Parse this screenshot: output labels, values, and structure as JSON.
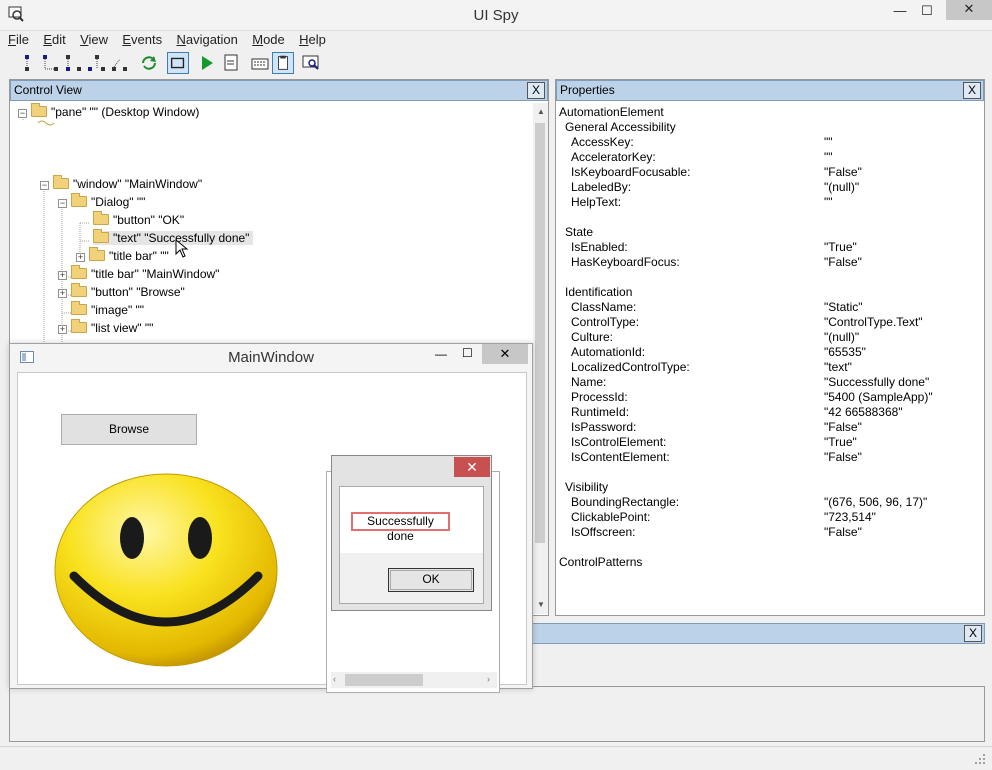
{
  "app": {
    "title": "UI Spy"
  },
  "menu": [
    "File",
    "Edit",
    "View",
    "Events",
    "Navigation",
    "Mode",
    "Help"
  ],
  "toolbar_icons": [
    "navigate-parent-icon",
    "navigate-first-child-icon",
    "navigate-next-sibling-icon",
    "navigate-prev-sibling-icon",
    "navigate-last-child-icon",
    "refresh-icon",
    "hover-mode-icon",
    "play-icon",
    "focus-tracking-icon",
    "keyboard-icon",
    "clipboard-icon",
    "screen-capture-icon"
  ],
  "control_view": {
    "title": "Control View",
    "close": "X",
    "tree": [
      {
        "text": "\"pane\" \"\" (Desktop Window)"
      },
      {
        "text": "\"window\" \"MainWindow\""
      },
      {
        "text": "\"Dialog\" \"\""
      },
      {
        "text": "\"button\" \"OK\""
      },
      {
        "text": "\"text\" \"Successfully done\""
      },
      {
        "text": "\"title bar\" \"\""
      },
      {
        "text": "\"title bar\" \"MainWindow\""
      },
      {
        "text": "\"button\" \"Browse\""
      },
      {
        "text": "\"image\" \"\""
      },
      {
        "text": "\"list view\" \"\""
      }
    ]
  },
  "properties": {
    "title": "Properties",
    "close": "X",
    "root": "AutomationElement",
    "sections": [
      {
        "name": "General Accessibility",
        "rows": [
          {
            "k": "AccessKey:",
            "v": "\"\""
          },
          {
            "k": "AcceleratorKey:",
            "v": "\"\""
          },
          {
            "k": "IsKeyboardFocusable:",
            "v": "\"False\""
          },
          {
            "k": "LabeledBy:",
            "v": "\"(null)\""
          },
          {
            "k": "HelpText:",
            "v": "\"\""
          }
        ]
      },
      {
        "name": "State",
        "rows": [
          {
            "k": "IsEnabled:",
            "v": "\"True\""
          },
          {
            "k": "HasKeyboardFocus:",
            "v": "\"False\""
          }
        ]
      },
      {
        "name": "Identification",
        "rows": [
          {
            "k": "ClassName:",
            "v": "\"Static\""
          },
          {
            "k": "ControlType:",
            "v": "\"ControlType.Text\""
          },
          {
            "k": "Culture:",
            "v": "\"(null)\""
          },
          {
            "k": "AutomationId:",
            "v": "\"65535\""
          },
          {
            "k": "LocalizedControlType:",
            "v": "\"text\""
          },
          {
            "k": "Name:",
            "v": "\"Successfully done\""
          },
          {
            "k": "ProcessId:",
            "v": "\"5400 (SampleApp)\""
          },
          {
            "k": "RuntimeId:",
            "v": "\"42 66588368\""
          },
          {
            "k": "IsPassword:",
            "v": "\"False\""
          },
          {
            "k": "IsControlElement:",
            "v": "\"True\""
          },
          {
            "k": "IsContentElement:",
            "v": "\"False\""
          }
        ]
      },
      {
        "name": "Visibility",
        "rows": [
          {
            "k": "BoundingRectangle:",
            "v": "\"(676, 506, 96, 17)\""
          },
          {
            "k": "ClickablePoint:",
            "v": "\"723,514\""
          },
          {
            "k": "IsOffscreen:",
            "v": "\"False\""
          }
        ]
      }
    ],
    "footer_section": "ControlPatterns"
  },
  "lower_panel": {
    "close": "X"
  },
  "main_window": {
    "title": "MainWindow",
    "browse_label": "Browse",
    "dialog": {
      "text": "Successfully done",
      "ok_label": "OK"
    }
  },
  "colors": {
    "panel_header": "#bcd2e8",
    "dialog_close": "#c75050",
    "highlight": "#e07070"
  }
}
